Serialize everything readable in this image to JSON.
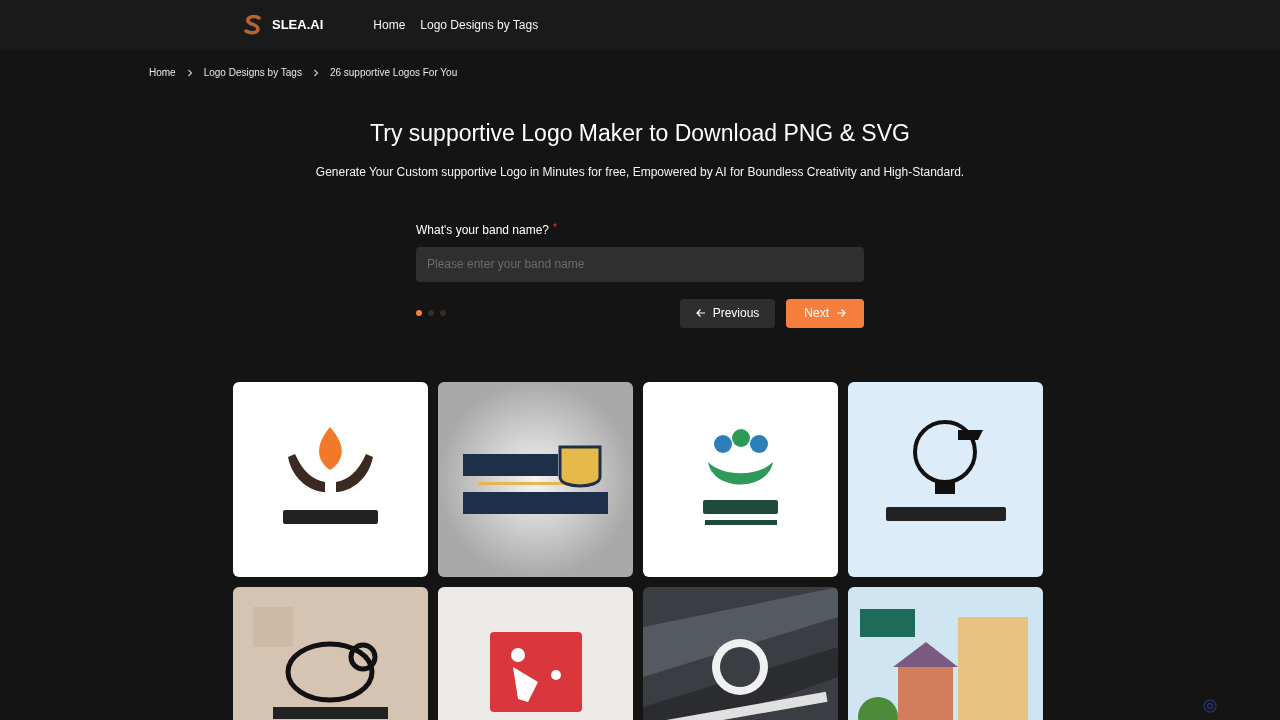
{
  "header": {
    "brand": "SLEA.AI",
    "nav": [
      {
        "label": "Home"
      },
      {
        "label": "Logo Designs by Tags"
      }
    ]
  },
  "breadcrumb": [
    {
      "label": "Home"
    },
    {
      "label": "Logo Designs by Tags"
    },
    {
      "label": "26 supportive Logos For You"
    }
  ],
  "hero": {
    "title": "Try supportive Logo Maker to Download PNG & SVG",
    "subtitle": "Generate Your Custom supportive Logo in Minutes for free, Empowered by AI for Boundless Creativity and High-Standard."
  },
  "form": {
    "label": "What's your band name?",
    "required_mark": "*",
    "placeholder": "Please enter your band name",
    "steps": [
      {
        "selected": true
      },
      {
        "selected": false
      },
      {
        "selected": false
      }
    ],
    "previous": "Previous",
    "next": "Next"
  }
}
